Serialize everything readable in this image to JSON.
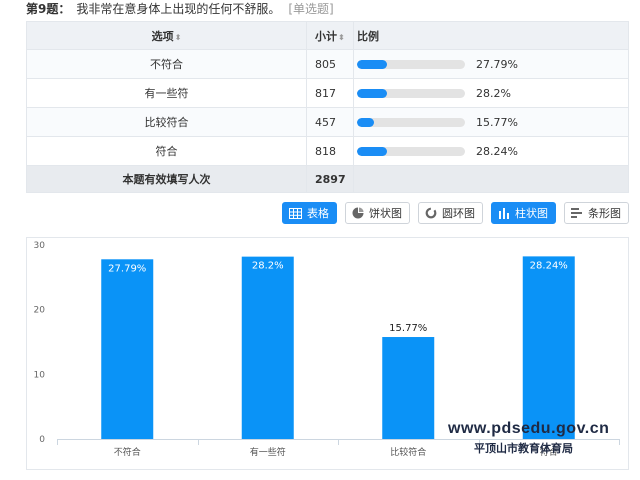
{
  "question": {
    "number": "第9题：",
    "text": "我非常在意身体上出现的任何不舒服。",
    "type": "[单选题]"
  },
  "table": {
    "headers": {
      "option": "选项",
      "count": "小计",
      "ratio": "比例"
    },
    "sort_icon": "⬍",
    "rows": [
      {
        "option": "不符合",
        "count": "805",
        "percent": "27.79%",
        "fraction": 0.2779
      },
      {
        "option": "有一些符",
        "count": "817",
        "percent": "28.2%",
        "fraction": 0.282
      },
      {
        "option": "比较符合",
        "count": "457",
        "percent": "15.77%",
        "fraction": 0.1577
      },
      {
        "option": "符合",
        "count": "818",
        "percent": "28.24%",
        "fraction": 0.2824
      }
    ],
    "total": {
      "label": "本题有效填写人次",
      "count": "2897"
    }
  },
  "view_buttons": [
    {
      "label": "表格",
      "icon": "table-icon",
      "active": true
    },
    {
      "label": "饼状图",
      "icon": "pie-chart-icon",
      "active": false
    },
    {
      "label": "圆环图",
      "icon": "ring-chart-icon",
      "active": false
    },
    {
      "label": "柱状图",
      "icon": "bar-chart-icon",
      "active": true
    },
    {
      "label": "条形图",
      "icon": "horizontal-bar-icon",
      "active": false
    }
  ],
  "colors": {
    "accent": "#1a8df5",
    "bar": "#0a93f7",
    "track": "#e3e3e3"
  },
  "chart_data": {
    "type": "bar",
    "categories": [
      "不符合",
      "有一些符",
      "比较符合",
      "符合"
    ],
    "values": [
      27.79,
      28.2,
      15.77,
      28.24
    ],
    "data_labels": [
      "27.79%",
      "28.2%",
      "15.77%",
      "28.24%"
    ],
    "ylim": [
      0,
      30
    ],
    "yticks": [
      "0",
      "10",
      "20",
      "30"
    ],
    "grid": false,
    "title": "",
    "xlabel": "",
    "ylabel": ""
  },
  "watermark": {
    "line1": "www.pdsedu.gov.cn",
    "line2": "平顶山市教育体育局"
  }
}
